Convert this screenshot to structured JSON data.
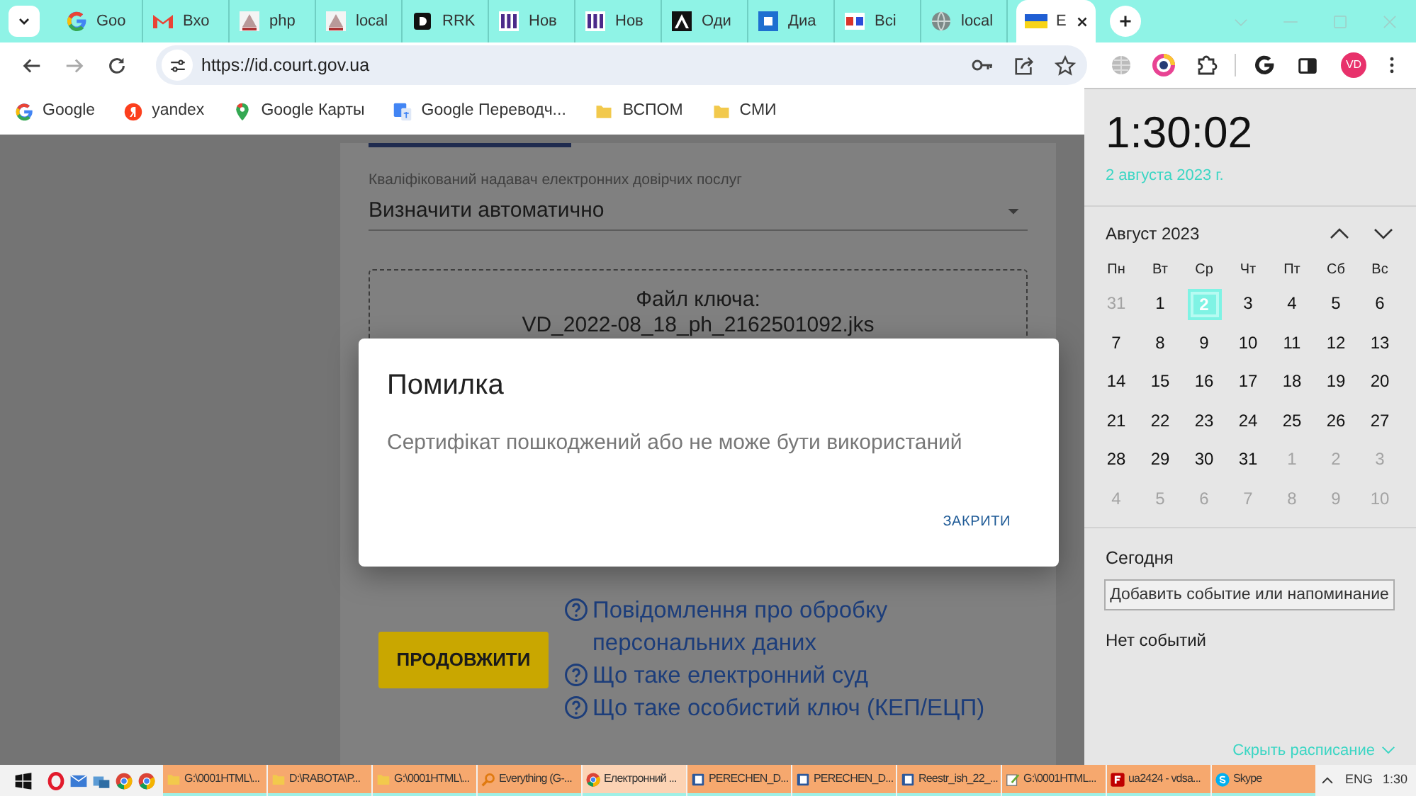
{
  "tab_strip": {
    "tabs": [
      {
        "label": "Goo",
        "kind": "google",
        "selected": false
      },
      {
        "label": "Вхо",
        "kind": "gmail",
        "selected": false
      },
      {
        "label": "php",
        "kind": "psba",
        "selected": false
      },
      {
        "label": "local",
        "kind": "psba",
        "selected": false
      },
      {
        "label": "RRK",
        "kind": "dark",
        "selected": false
      },
      {
        "label": "Нов",
        "kind": "pps",
        "selected": false
      },
      {
        "label": "Нов",
        "kind": "pps",
        "selected": false
      },
      {
        "label": "Оди",
        "kind": "az",
        "selected": false
      },
      {
        "label": "Диа",
        "kind": "blue",
        "selected": false
      },
      {
        "label": "Всі",
        "kind": "cn",
        "selected": false
      },
      {
        "label": "local",
        "kind": "globe",
        "selected": false
      },
      {
        "label": "E",
        "kind": "flag",
        "selected": true
      }
    ]
  },
  "toolbar": {
    "url": "https://id.court.gov.ua",
    "forward_disabled": true,
    "avatar": "VD"
  },
  "bookmarks": [
    {
      "label": "Google",
      "kind": "google"
    },
    {
      "label": "yandex",
      "kind": "yandex"
    },
    {
      "label": "Google Карты",
      "kind": "maps"
    },
    {
      "label": "Google Переводч...",
      "kind": "translate"
    },
    {
      "label": "ВСПОМ",
      "kind": "folder"
    },
    {
      "label": "СМИ",
      "kind": "folder"
    }
  ],
  "page": {
    "field_label": "Кваліфікований надавач електронних довірчих послуг",
    "select_value": "Визначити автоматично",
    "file_label": "Файл ключа:",
    "file_name": "VD_2022-08_18_ph_2162501092.jks",
    "submit": "ПРОДОВЖИТИ",
    "links": [
      "Повідомлення про обробку персональних даних",
      "Що таке електронний суд",
      "Що таке особистий ключ (КЕП/ЕЦП)"
    ]
  },
  "dialog": {
    "title": "Помилка",
    "message": "Сертифікат пошкоджений або не може бути використаний",
    "button": "ЗАКРИТИ"
  },
  "clock_panel": {
    "time": "1:30:02",
    "date": "2 августа 2023 г.",
    "month": "Август 2023",
    "weekdays": [
      "Пн",
      "Вт",
      "Ср",
      "Чт",
      "Пт",
      "Сб",
      "Вс"
    ],
    "weeks": [
      [
        {
          "day": "31",
          "muted": true,
          "selected": false
        },
        {
          "day": "1",
          "muted": false,
          "selected": false
        },
        {
          "day": "2",
          "muted": false,
          "selected": true
        },
        {
          "day": "3",
          "muted": false,
          "selected": false
        },
        {
          "day": "4",
          "muted": false,
          "selected": false
        },
        {
          "day": "5",
          "muted": false,
          "selected": false
        },
        {
          "day": "6",
          "muted": false,
          "selected": false
        }
      ],
      [
        {
          "day": "7",
          "muted": false,
          "selected": false
        },
        {
          "day": "8",
          "muted": false,
          "selected": false
        },
        {
          "day": "9",
          "muted": false,
          "selected": false
        },
        {
          "day": "10",
          "muted": false,
          "selected": false
        },
        {
          "day": "11",
          "muted": false,
          "selected": false
        },
        {
          "day": "12",
          "muted": false,
          "selected": false
        },
        {
          "day": "13",
          "muted": false,
          "selected": false
        }
      ],
      [
        {
          "day": "14",
          "muted": false,
          "selected": false
        },
        {
          "day": "15",
          "muted": false,
          "selected": false
        },
        {
          "day": "16",
          "muted": false,
          "selected": false
        },
        {
          "day": "17",
          "muted": false,
          "selected": false
        },
        {
          "day": "18",
          "muted": false,
          "selected": false
        },
        {
          "day": "19",
          "muted": false,
          "selected": false
        },
        {
          "day": "20",
          "muted": false,
          "selected": false
        }
      ],
      [
        {
          "day": "21",
          "muted": false,
          "selected": false
        },
        {
          "day": "22",
          "muted": false,
          "selected": false
        },
        {
          "day": "23",
          "muted": false,
          "selected": false
        },
        {
          "day": "24",
          "muted": false,
          "selected": false
        },
        {
          "day": "25",
          "muted": false,
          "selected": false
        },
        {
          "day": "26",
          "muted": false,
          "selected": false
        },
        {
          "day": "27",
          "muted": false,
          "selected": false
        }
      ],
      [
        {
          "day": "28",
          "muted": false,
          "selected": false
        },
        {
          "day": "29",
          "muted": false,
          "selected": false
        },
        {
          "day": "30",
          "muted": false,
          "selected": false
        },
        {
          "day": "31",
          "muted": false,
          "selected": false
        },
        {
          "day": "1",
          "muted": true,
          "selected": false
        },
        {
          "day": "2",
          "muted": true,
          "selected": false
        },
        {
          "day": "3",
          "muted": true,
          "selected": false
        }
      ],
      [
        {
          "day": "4",
          "muted": true,
          "selected": false
        },
        {
          "day": "5",
          "muted": true,
          "selected": false
        },
        {
          "day": "6",
          "muted": true,
          "selected": false
        },
        {
          "day": "7",
          "muted": true,
          "selected": false
        },
        {
          "day": "8",
          "muted": true,
          "selected": false
        },
        {
          "day": "9",
          "muted": true,
          "selected": false
        },
        {
          "day": "10",
          "muted": true,
          "selected": false
        }
      ]
    ],
    "agenda_title": "Сегодня",
    "add_button": "Добавить событие или напоминание",
    "empty_text": "Нет событий",
    "hide_link": "Скрыть расписание"
  },
  "taskbar": {
    "pinned": [
      {
        "kind": "opera"
      },
      {
        "kind": "mail"
      },
      {
        "kind": "app"
      },
      {
        "kind": "chrome"
      },
      {
        "kind": "chrome"
      }
    ],
    "tasks": [
      {
        "label": "G:\\0001HTML\\...",
        "kind": "folder",
        "selected": false
      },
      {
        "label": "D:\\RABOTA\\P...",
        "kind": "folder",
        "selected": false
      },
      {
        "label": "G:\\0001HTML\\...",
        "kind": "folder",
        "selected": false
      },
      {
        "label": "Everything (G-...",
        "kind": "search",
        "selected": false
      },
      {
        "label": "Електронний ...",
        "kind": "chrome",
        "selected": true
      },
      {
        "label": "PERECHEN_D...",
        "kind": "doc",
        "selected": false
      },
      {
        "label": "PERECHEN_D...",
        "kind": "doc",
        "selected": false
      },
      {
        "label": "Reestr_ish_22_...",
        "kind": "doc",
        "selected": false
      },
      {
        "label": "G:\\0001HTML...",
        "kind": "notepad",
        "selected": false
      },
      {
        "label": "ua2424 - vdsa...",
        "kind": "filezilla",
        "selected": false
      },
      {
        "label": "Skype",
        "kind": "skype",
        "selected": false
      }
    ],
    "language": "ENG",
    "time": "1:30"
  }
}
